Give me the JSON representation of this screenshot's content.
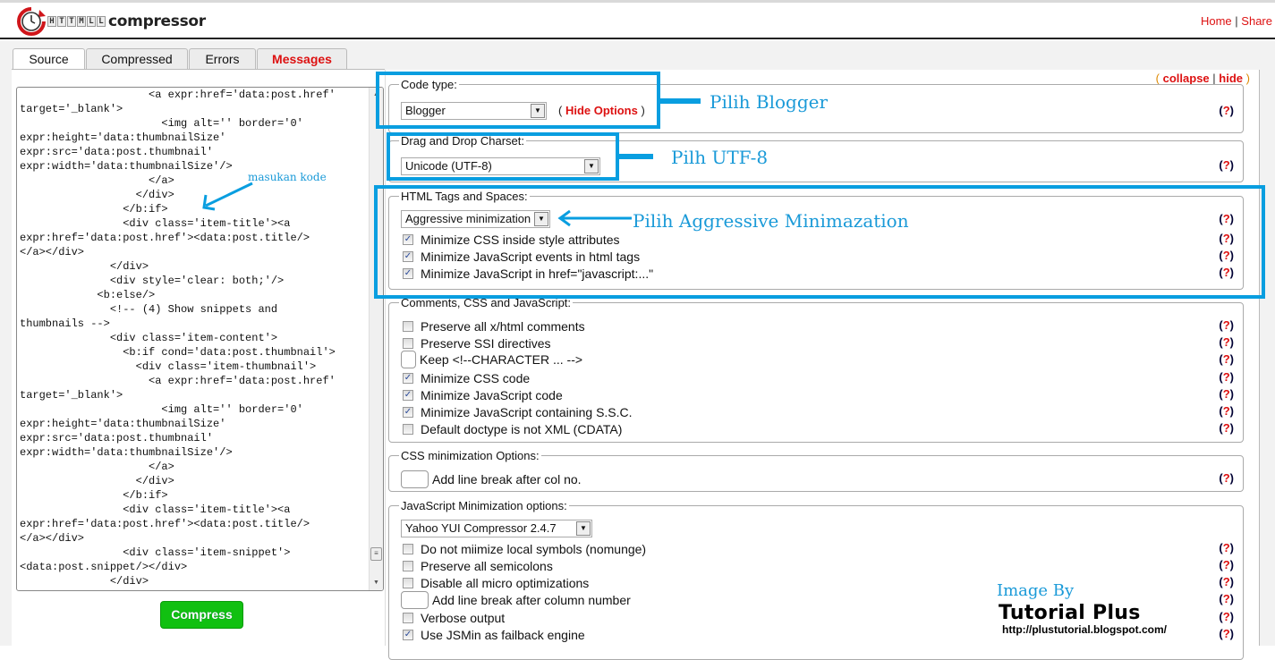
{
  "app": {
    "logo_text": "compressor",
    "logo_blocks": [
      "H",
      "T",
      "T",
      "M",
      "L",
      "L"
    ]
  },
  "header": {
    "links": [
      {
        "label": "Home"
      },
      {
        "label": "Share"
      }
    ],
    "separator": "|"
  },
  "tabs": [
    {
      "label": "Source",
      "active": true
    },
    {
      "label": "Compressed",
      "active": false
    },
    {
      "label": "Errors",
      "active": false
    },
    {
      "label": "Messages",
      "active": false,
      "highlight": true
    }
  ],
  "source": {
    "code": "                    <a expr:href='data:post.href'\ntarget='_blank'>\n                      <img alt='' border='0'\nexpr:height='data:thumbnailSize'\nexpr:src='data:post.thumbnail'\nexpr:width='data:thumbnailSize'/>\n                    </a>\n                  </div>\n                </b:if>\n                <div class='item-title'><a\nexpr:href='data:post.href'><data:post.title/>\n</a></div>\n              </div>\n              <div style='clear: both;'/>\n            <b:else/>\n              <!-- (4) Show snippets and\nthumbnails -->\n              <div class='item-content'>\n                <b:if cond='data:post.thumbnail'>\n                  <div class='item-thumbnail'>\n                    <a expr:href='data:post.href'\ntarget='_blank'>\n                      <img alt='' border='0'\nexpr:height='data:thumbnailSize'\nexpr:src='data:post.thumbnail'\nexpr:width='data:thumbnailSize'/>\n                    </a>\n                  </div>\n                </b:if>\n                <div class='item-title'><a\nexpr:href='data:post.href'><data:post.title/>\n</a></div>\n                <div class='item-snippet'>\n<data:post.snippet/></div>\n              </div>",
    "compress_label": "Compress"
  },
  "options": {
    "collapse_open": "(",
    "collapse_label": "collapse",
    "hide_label": "hide",
    "collapse_close": ")",
    "help_label": "(?)",
    "code_type": {
      "legend": "Code type:",
      "selected": "Blogger",
      "hide_options_open": "(",
      "hide_options": "Hide Options",
      "hide_options_close": ")"
    },
    "charset": {
      "legend": "Drag and Drop Charset:",
      "selected": "Unicode (UTF-8)"
    },
    "html_tags": {
      "legend": "HTML Tags and Spaces:",
      "selected": "Aggressive minimization",
      "items": [
        {
          "label": "Minimize CSS inside style attributes",
          "checked": true
        },
        {
          "label": "Minimize JavaScript events in html tags",
          "checked": true
        },
        {
          "label": "Minimize JavaScript in href=\"javascript:...\"",
          "checked": true
        }
      ]
    },
    "comments": {
      "legend": "Comments, CSS and JavaScript:",
      "items": [
        {
          "label": "Preserve all x/html comments",
          "checked": false
        },
        {
          "label": "Preserve SSI directives",
          "checked": false
        },
        {
          "label": "Keep <!--CHARACTER ... -->",
          "input": true,
          "value": ""
        },
        {
          "label": "Minimize CSS code",
          "checked": true
        },
        {
          "label": "Minimize JavaScript code",
          "checked": true
        },
        {
          "label": "Minimize JavaScript containing S.S.C.",
          "checked": true
        },
        {
          "label": "Default doctype is not XML (CDATA)",
          "checked": false
        }
      ]
    },
    "css_min": {
      "legend": "CSS minimization Options:",
      "items": [
        {
          "label": "Add line break after col no.",
          "input": true,
          "value": ""
        }
      ]
    },
    "js_min": {
      "legend": "JavaScript Minimization options:",
      "selected": "Yahoo YUI Compressor 2.4.7",
      "items": [
        {
          "label": "Do not miimize local symbols (nomunge)",
          "checked": false
        },
        {
          "label": "Preserve all semicolons",
          "checked": false
        },
        {
          "label": "Disable all micro optimizations",
          "checked": false
        },
        {
          "label": "Add line break after column number",
          "input": true,
          "value": ""
        },
        {
          "label": "Verbose output",
          "checked": false
        },
        {
          "label": "Use JSMin as failback engine",
          "checked": true
        }
      ]
    }
  },
  "annotations": {
    "pilih_blogger": "Pilih Blogger",
    "pilih_utf8": "Pilh UTF-8",
    "pilih_aggressive": "Pilih Aggressive Minimazation",
    "masukan_kode": "masukan kode",
    "image_by": "Image By",
    "brand": "Tutorial Plus",
    "url": "http://plustutorial.blogspot.com/",
    "color": "#099ee0"
  },
  "icons": {
    "checkbox_checked": "✓",
    "dropdown_arrow": "▼",
    "scroll_up": "▲",
    "scroll_down": "▼",
    "scroll_grip": "≡"
  }
}
